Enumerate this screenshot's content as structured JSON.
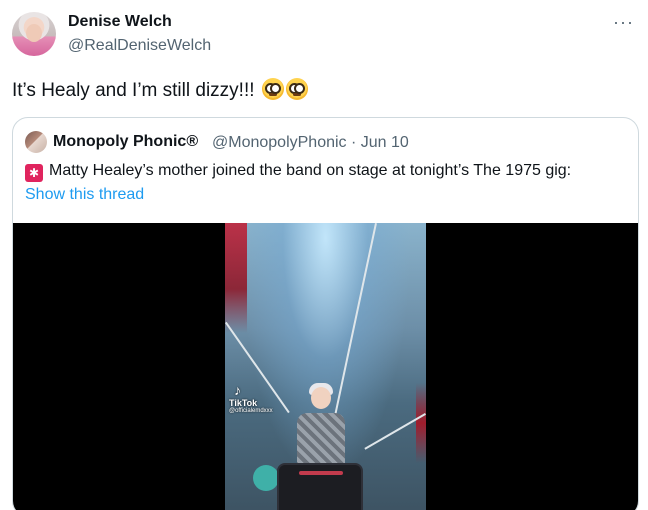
{
  "author": {
    "name": "Denise Welch",
    "handle": "@RealDeniseWelch",
    "avatar_icon": "profile-photo"
  },
  "more_label": "···",
  "tweet": {
    "text": "It’s Healy and I’m still dizzy!!!",
    "emojis": [
      "flushed-face-icon",
      "flushed-face-icon"
    ]
  },
  "quoted": {
    "name": "Monopoly Phonic®",
    "meta": "@MonopolyPhonic · Jun 10",
    "emoji": "police-siren-icon",
    "text": "Matty Healey’s mother joined the band on stage at tonight’s The 1975 gig:",
    "show_thread": "Show this thread",
    "media": {
      "watermark_brand": "TikTok",
      "watermark_user": "@officialemdxxx"
    }
  },
  "colors": {
    "link": "#1d9bf0",
    "secondary_text": "#536471",
    "border": "#cfd9de",
    "media_background": "#000000"
  }
}
